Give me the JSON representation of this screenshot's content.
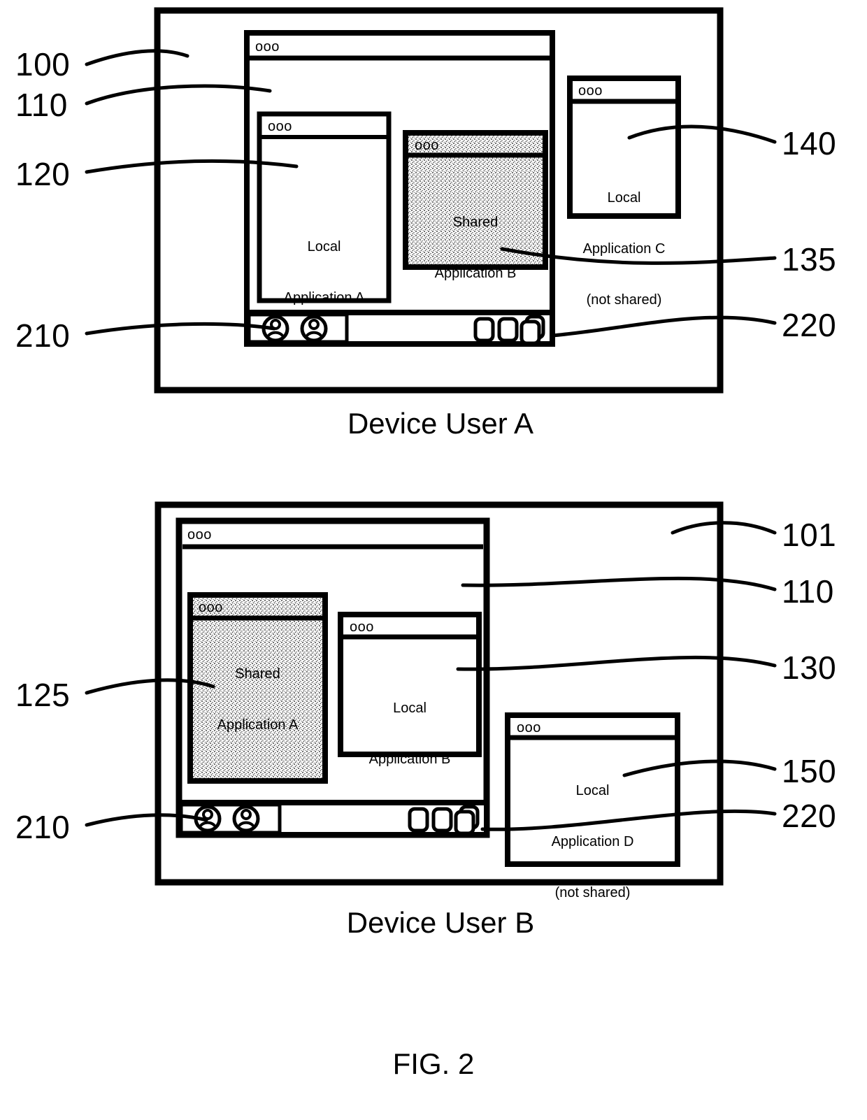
{
  "figure": {
    "label": "FIG. 2",
    "type": "patent-diagram"
  },
  "panels": [
    {
      "id": "device-user-a",
      "caption": "Device User A",
      "frame_ref": "100",
      "desktop_ref": "110",
      "titlebar_dots": "ooo",
      "windows": [
        {
          "id": "local-app-a",
          "title_dots": "ooo",
          "lines": [
            "Local",
            "Application A"
          ],
          "shared": false,
          "ref": "120"
        },
        {
          "id": "shared-app-b",
          "title_dots": "ooo",
          "lines": [
            "Shared",
            "Application B"
          ],
          "shared": true,
          "ref": "135"
        },
        {
          "id": "local-app-c",
          "title_dots": "ooo",
          "lines": [
            "Local",
            "Application C",
            "(not shared)"
          ],
          "shared": false,
          "ref": "140"
        }
      ],
      "taskbar": {
        "ref_avatars": "210",
        "ref_windows": "220",
        "avatar_count": 2,
        "window_icon_count": 3
      }
    },
    {
      "id": "device-user-b",
      "caption": "Device User B",
      "frame_ref": "101",
      "desktop_ref": "110",
      "titlebar_dots": "ooo",
      "windows": [
        {
          "id": "shared-app-a",
          "title_dots": "ooo",
          "lines": [
            "Shared",
            "Application A"
          ],
          "shared": true,
          "ref": "125"
        },
        {
          "id": "local-app-b",
          "title_dots": "ooo",
          "lines": [
            "Local",
            "Application B"
          ],
          "shared": false,
          "ref": "130"
        },
        {
          "id": "local-app-d",
          "title_dots": "ooo",
          "lines": [
            "Local",
            "Application D",
            "(not shared)"
          ],
          "shared": false,
          "ref": "150"
        }
      ],
      "taskbar": {
        "ref_avatars": "210",
        "ref_windows": "220",
        "avatar_count": 2,
        "window_icon_count": 3
      }
    }
  ],
  "reference_numerals": {
    "top": {
      "n100": "100",
      "n110": "110",
      "n120": "120",
      "n210": "210",
      "n140": "140",
      "n135": "135",
      "n220": "220"
    },
    "bottom": {
      "n101": "101",
      "n110": "110",
      "n130": "130",
      "n125": "125",
      "n150": "150",
      "n210": "210",
      "n220": "220"
    }
  },
  "colors": {
    "stroke": "#000000",
    "background": "#ffffff",
    "shared_fill": "#d9d9d9"
  }
}
